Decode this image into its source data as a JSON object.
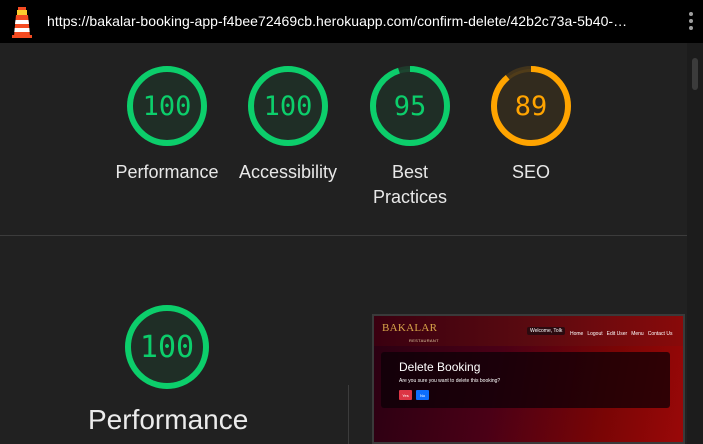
{
  "browser": {
    "url": "https://bakalar-booking-app-f4bee72469cb.herokuapp.com/confirm-delete/42b2c73a-5b40-…",
    "logo_icon": "lighthouse-icon",
    "menu_icon": "kebab-menu-icon"
  },
  "gauges": [
    {
      "score": "100",
      "label": "Performance",
      "fraction": 1.0,
      "color": "#0cce6b"
    },
    {
      "score": "100",
      "label": "Accessibility",
      "fraction": 1.0,
      "color": "#0cce6b"
    },
    {
      "score": "95",
      "label": "Best Practices",
      "fraction": 0.95,
      "color": "#0cce6b"
    },
    {
      "score": "89",
      "label": "SEO",
      "fraction": 0.89,
      "color": "#ffa400"
    }
  ],
  "performance_section": {
    "score": "100",
    "fraction": 1.0,
    "color": "#0cce6b",
    "title": "Performance"
  },
  "page_screenshot": {
    "brand": "BAKALAR",
    "brand_sub": "RESTAURANT",
    "welcome": "Welcome, Tolk",
    "menu": [
      "Home",
      "Logout",
      "Edit User",
      "Menu",
      "Contact Us"
    ],
    "card_title": "Delete Booking",
    "card_text": "Are you sure you want to delete this booking?",
    "yes_label": "Yes",
    "no_label": "No"
  }
}
